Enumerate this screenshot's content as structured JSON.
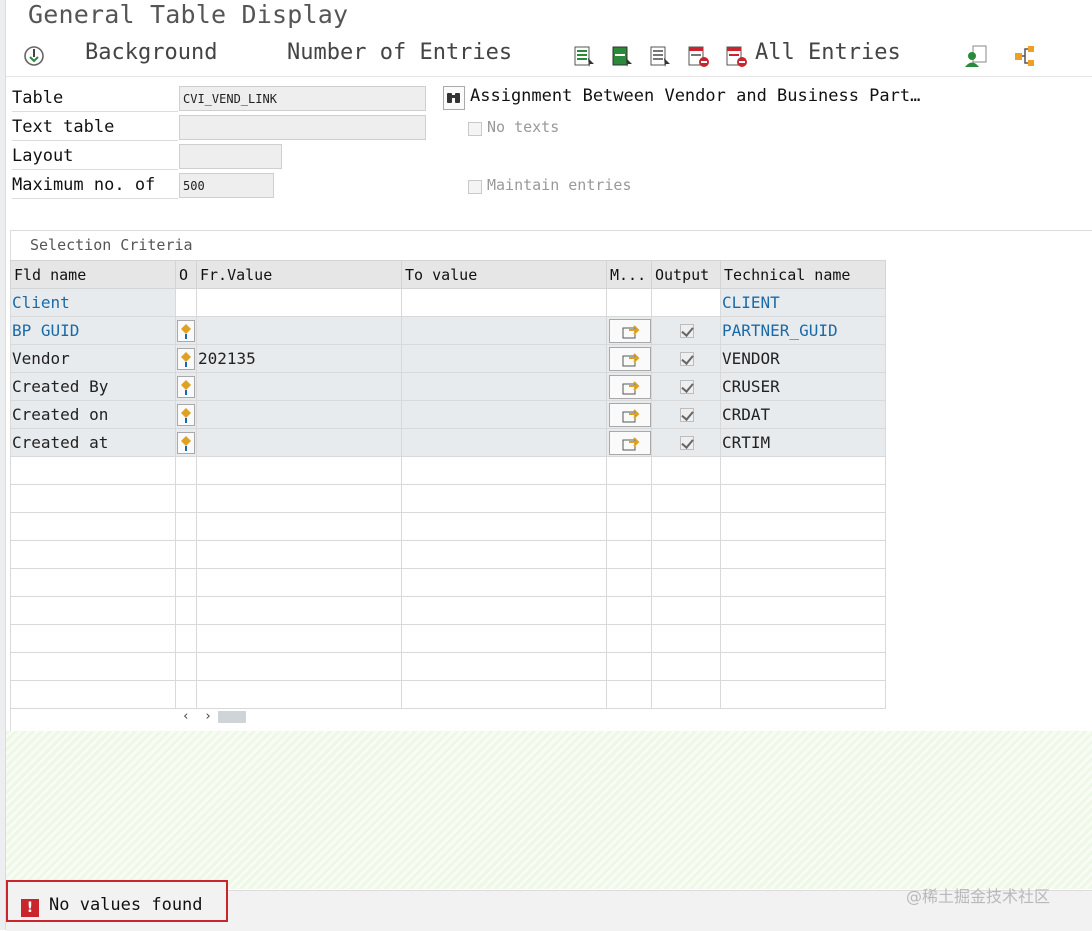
{
  "window": {
    "title": "General Table Display"
  },
  "toolbar": {
    "background_label": "Background",
    "number_of_entries_label": "Number of Entries",
    "all_entries_label": "All Entries"
  },
  "header": {
    "table_label": "Table",
    "table_value": "CVI_VEND_LINK",
    "text_table_label": "Text table",
    "text_table_value": "",
    "layout_label": "Layout",
    "layout_value": "",
    "max_label": "Maximum no. of",
    "max_value": "500",
    "description": "Assignment Between Vendor and Business Part…",
    "no_texts_label": "No texts",
    "maintain_entries_label": "Maintain entries"
  },
  "selection": {
    "title": "Selection Criteria",
    "columns": [
      "Fld name",
      "O",
      "Fr.Value",
      "To value",
      "M...",
      "Output",
      "Technical name"
    ],
    "rows": [
      {
        "fld_name": "Client",
        "fr_value": "",
        "to_value": "",
        "technical_name": "CLIENT"
      },
      {
        "fld_name": "BP GUID",
        "fr_value": "",
        "to_value": "",
        "technical_name": "PARTNER_GUID"
      },
      {
        "fld_name": "Vendor",
        "fr_value": "202135",
        "to_value": "",
        "technical_name": "VENDOR"
      },
      {
        "fld_name": "Created By",
        "fr_value": "",
        "to_value": "",
        "technical_name": "CRUSER"
      },
      {
        "fld_name": "Created on",
        "fr_value": "",
        "to_value": "",
        "technical_name": "CRDAT"
      },
      {
        "fld_name": "Created at",
        "fr_value": "",
        "to_value": "",
        "technical_name": "CRTIM"
      }
    ]
  },
  "status": {
    "message": "No values found",
    "type": "error"
  },
  "watermark": "@稀土掘金技术社区",
  "colors": {
    "error": "#c8252c",
    "key_field": "#1a6aa8",
    "success_green": "#2a8a3a"
  }
}
